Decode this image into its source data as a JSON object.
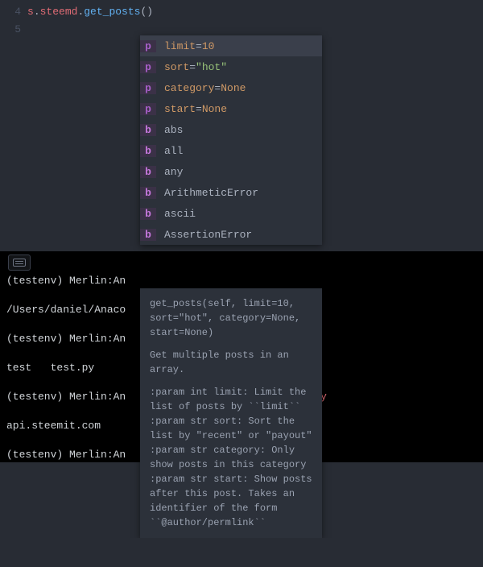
{
  "editor": {
    "lines": [
      {
        "num": "4",
        "content": ""
      },
      {
        "num": "5",
        "tokens": [
          "s",
          ".",
          "steemd",
          ".",
          "get_posts",
          "(",
          ")"
        ]
      }
    ]
  },
  "autocomplete": {
    "items": [
      {
        "kind": "p",
        "name": "limit",
        "op": "=",
        "value": "10",
        "valueType": "num",
        "selected": true
      },
      {
        "kind": "p",
        "name": "sort",
        "op": "=",
        "value": "\"hot\"",
        "valueType": "str"
      },
      {
        "kind": "p",
        "name": "category",
        "op": "=",
        "value": "None",
        "valueType": "none"
      },
      {
        "kind": "p",
        "name": "start",
        "op": "=",
        "value": "None",
        "valueType": "none"
      },
      {
        "kind": "b",
        "name": "abs"
      },
      {
        "kind": "b",
        "name": "all"
      },
      {
        "kind": "b",
        "name": "any"
      },
      {
        "kind": "b",
        "name": "ArithmeticError"
      },
      {
        "kind": "b",
        "name": "ascii"
      },
      {
        "kind": "b",
        "name": "AssertionError"
      }
    ],
    "doc": {
      "signature": "get_posts(self, limit=10, sort=\"hot\", category=None, start=None)",
      "summary": "Get multiple posts in an array.",
      "params": [
        ":param int limit: Limit the list of posts by ``limit``",
        ":param str sort: Sort the list by \"recent\" or \"payout\"",
        ":param str category: Only show posts in this category",
        ":param str start: Show posts after this post. Takes an",
        "             identifier of the form ``@author/permlink``"
      ]
    }
  },
  "terminal": {
    "lines": [
      "(testenv) Merlin:An",
      "/Users/daniel/Anaco",
      "(testenv) Merlin:An",
      "test   test.py",
      "(testenv) Merlin:An                         test.py",
      "api.steemit.com",
      "(testenv) Merlin:An"
    ]
  },
  "toolbar": {
    "keyboard_title": "Toggle keyboard"
  }
}
